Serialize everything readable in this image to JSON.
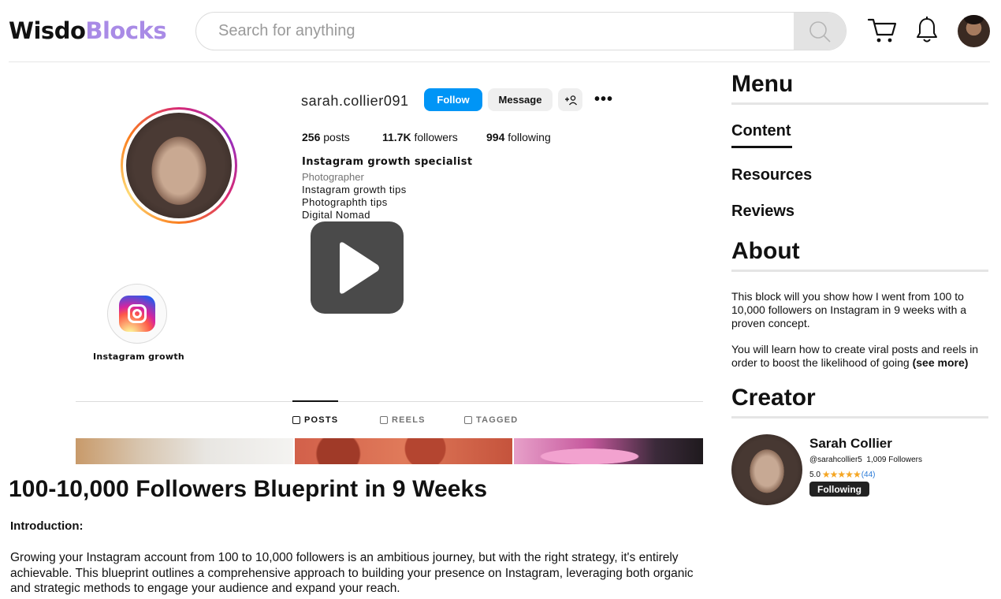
{
  "header": {
    "logo_part1": "Wisdo",
    "logo_part2": "Blocks",
    "search_placeholder": "Search for anything",
    "icons": [
      "search-icon",
      "cart-icon",
      "bell-icon",
      "avatar"
    ]
  },
  "media": {
    "profile": {
      "username": "sarah.collier091",
      "follow_label": "Follow",
      "message_label": "Message",
      "add_person_label": "+A",
      "more_label": "•••",
      "stats": [
        {
          "value": "256",
          "label": "posts"
        },
        {
          "value": "11.7K",
          "label": "followers"
        },
        {
          "value": "994",
          "label": "following"
        }
      ],
      "bio_name": "Instagram growth specialist",
      "bio_category": "Photographer",
      "bio_lines": [
        "Instagram growth tips",
        "Photographth tips",
        "Digital Nomad"
      ],
      "highlight_label": "Instagram growth",
      "tabs": [
        "POSTS",
        "REELS",
        "TAGGED"
      ]
    },
    "play_icon": "play-icon"
  },
  "article": {
    "title": "100-10,000 Followers Blueprint in 9 Weeks",
    "intro_heading": "Introduction:",
    "body": "Growing your Instagram account from 100 to 10,000 followers is an ambitious journey, but with the right strategy, it's entirely achievable. This blueprint outlines a comprehensive approach to building your presence on Instagram, leveraging both organic and strategic methods to engage your audience and expand your reach."
  },
  "sidebar": {
    "menu_heading": "Menu",
    "menu_items": [
      "Content",
      "Resources",
      "Reviews"
    ],
    "active_item": "Content",
    "about_heading": "About",
    "about_p1": "This block will you show how I went from 100 to 10,000 followers on Instagram in 9 weeks with a proven concept.",
    "about_p2": "You will learn how to create viral posts and reels in order to boost the likelihood of going",
    "see_more": "(see more)",
    "creator_heading": "Creator",
    "creator": {
      "name": "Sarah Collier",
      "handle": "@sarahcollier5",
      "followers": "1,009 Followers",
      "rating": "5.0",
      "stars": "★★★★★",
      "rating_count": "(44)",
      "following_label": "Following"
    }
  },
  "colors": {
    "brand_dark": "#111111",
    "brand_purple": "#a98be6",
    "follow_blue": "#0095f6",
    "star": "#f5a623",
    "link_blue": "#2b7bd8"
  }
}
